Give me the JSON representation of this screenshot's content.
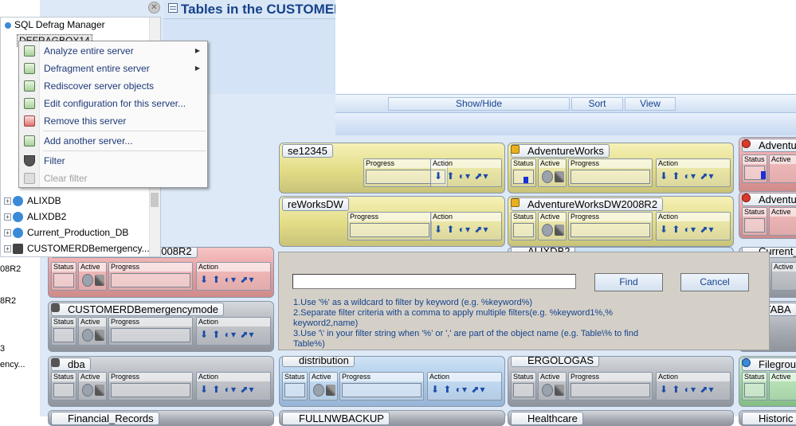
{
  "window": {
    "title": "Tables in the CUSTOMEF"
  },
  "left_strip": {
    "fragments": [
      "08R2",
      "8R2",
      "3",
      "ency..."
    ]
  },
  "toolbar": {
    "buttons": [
      "Show/Hide",
      "Sort",
      "View"
    ]
  },
  "tree": {
    "root": "SQL Defrag Manager",
    "selected_partial": "DEFRAGBOX14",
    "items": [
      {
        "label": "ALIXDB",
        "icon": "server-ok-icon"
      },
      {
        "label": "ALIXDB2",
        "icon": "server-ok-icon"
      },
      {
        "label": "Current_Production_DB",
        "icon": "server-ok-icon"
      },
      {
        "label": "CUSTOMERDBemergency...",
        "icon": "database-icon"
      }
    ]
  },
  "context_menu": {
    "items": [
      {
        "label": "Analyze entire server",
        "submenu": true,
        "enabled": true,
        "icon": "analyze-icon"
      },
      {
        "label": "Defragment entire server",
        "submenu": true,
        "enabled": true,
        "icon": "defragment-icon"
      },
      {
        "label": "Rediscover server objects",
        "submenu": false,
        "enabled": true,
        "icon": "rediscover-icon"
      },
      {
        "label": "Edit configuration for this server...",
        "submenu": false,
        "enabled": true,
        "icon": "edit-config-icon"
      },
      {
        "label": "Remove this server",
        "submenu": false,
        "enabled": true,
        "icon": "remove-server-icon"
      },
      {
        "label": "Add another server...",
        "submenu": false,
        "enabled": true,
        "icon": "add-server-icon"
      },
      {
        "label": "Filter",
        "submenu": false,
        "enabled": true,
        "icon": "filter-icon"
      },
      {
        "label": "Clear filter",
        "submenu": false,
        "enabled": false,
        "icon": "clear-filter-icon"
      }
    ]
  },
  "card_labels": {
    "status": "Status",
    "active": "Active",
    "progress": "Progress",
    "action": "Action"
  },
  "cards": [
    {
      "name": "se12345",
      "color": "yellow"
    },
    {
      "name": "AdventureWorks",
      "color": "yellow",
      "icon": "warning"
    },
    {
      "name": "Adventu",
      "color": "red",
      "icon": "error"
    },
    {
      "name": "reWorksDW",
      "color": "yellow"
    },
    {
      "name": "AdventureWorksDW2008R2",
      "color": "yellow",
      "icon": "warning"
    },
    {
      "name": "Adventu",
      "color": "red",
      "icon": "error"
    },
    {
      "name": "AdventureWorksLT2008R2",
      "color": "red",
      "icon": "error"
    },
    {
      "name": "ALIXDB2",
      "color": "blue"
    },
    {
      "name": "Current_",
      "color": "gray"
    },
    {
      "name": "CUSTOMERDBemergencymode",
      "color": "gray",
      "icon": "database"
    },
    {
      "name": "ATABA",
      "color": "gray"
    },
    {
      "name": "dba",
      "color": "gray",
      "icon": "database"
    },
    {
      "name": "distribution",
      "color": "blue"
    },
    {
      "name": "ERGOLOGAS",
      "color": "gray"
    },
    {
      "name": "Filegrou",
      "color": "green"
    },
    {
      "name": "Financial_Records",
      "color": "gray"
    },
    {
      "name": "FULLNWBACKUP",
      "color": "gray"
    },
    {
      "name": "Healthcare",
      "color": "gray"
    },
    {
      "name": "Historic",
      "color": "gray"
    }
  ],
  "find_dialog": {
    "input_value": "",
    "find_label": "Find",
    "cancel_label": "Cancel",
    "tips": [
      "1.Use '%' as a wildcard to filter by keyword (e.g. %keyword%)",
      "2.Separate filter criteria with a comma to apply multiple filters(e.g. %keyword1%,% keyword2,name)",
      "3.Use '\\' in your filter string when '%' or ',' are part of the object name (e.g. Table\\% to find Table%)"
    ]
  },
  "colors": {
    "accent": "#15428b",
    "card_yellow": "#e2dc86",
    "card_red": "#e69b9b",
    "card_blue": "#a9c9ea",
    "card_gray": "#a9adb4",
    "card_green": "#9bd59b"
  }
}
